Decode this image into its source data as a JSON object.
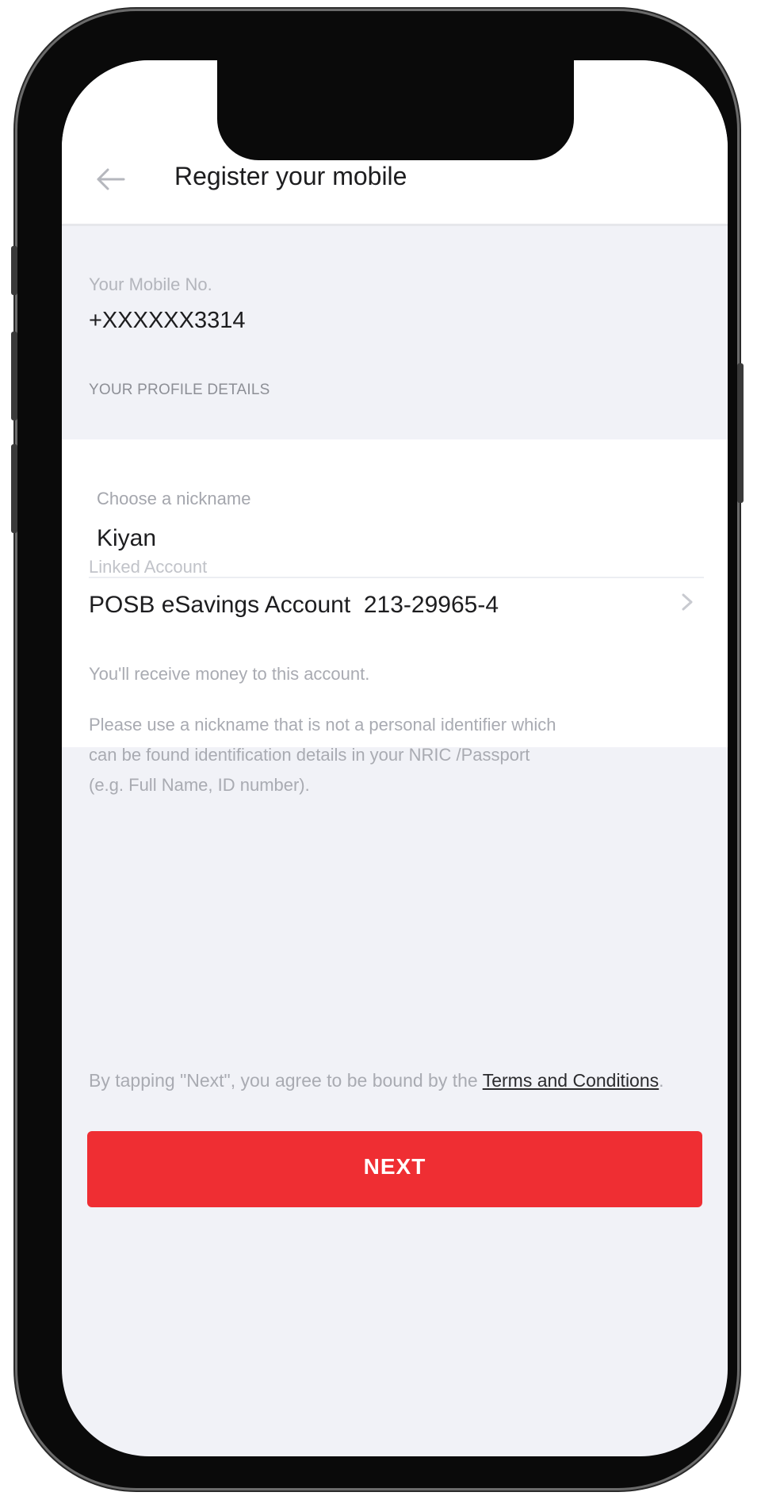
{
  "header": {
    "title": "Register your mobile",
    "back_icon": "arrow-left-icon"
  },
  "mobile": {
    "label": "Your Mobile No.",
    "value": "+XXXXXX3314"
  },
  "profile_section": {
    "heading": "YOUR PROFILE DETAILS"
  },
  "nickname": {
    "label": "Choose a nickname",
    "value": "Kiyan"
  },
  "linked_account": {
    "label": "Linked Account",
    "value": "POSB eSavings Account  213-29965-4",
    "chevron_icon": "chevron-right-icon"
  },
  "notes": {
    "receive": "You'll receive money to this account.",
    "nickname_advice_line1": "Please use a nickname that is not a personal identifier which",
    "nickname_advice_line2": "can be found identification details in your NRIC /Passport",
    "nickname_advice_line3": "(e.g. Full Name, ID number)."
  },
  "terms": {
    "prefix": "By tapping \"Next\", you agree to be bound by the ",
    "link_text": "Terms and Conditions",
    "suffix": "."
  },
  "next_button": {
    "label": "NEXT"
  },
  "colors": {
    "accent": "#ef2e33",
    "screen_bg": "#f1f2f7",
    "card_bg": "#ffffff"
  }
}
